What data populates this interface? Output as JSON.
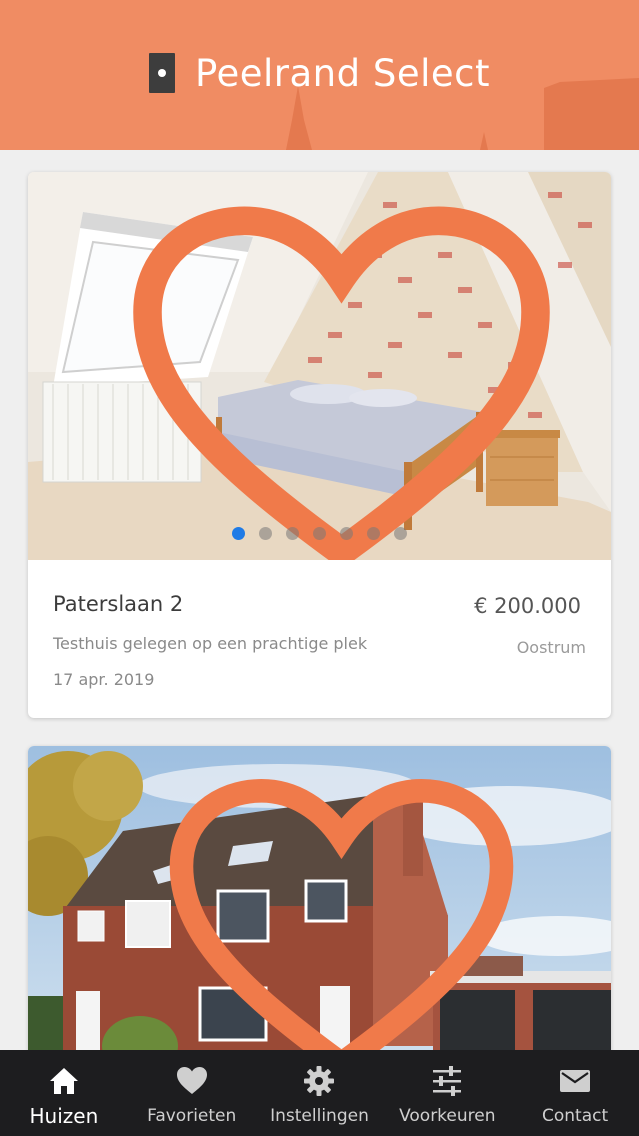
{
  "header": {
    "title": "Peelrand Select",
    "background_color": "#f08c63"
  },
  "listings": [
    {
      "street": "Paterslaan 2",
      "price": "€ 200.000",
      "description": "Testhuis gelegen op een prachtige plek",
      "place": "Oostrum",
      "date": "17 apr. 2019",
      "favorite": false,
      "photo_count": 7,
      "active_photo": 1
    },
    {
      "favorite": false
    }
  ],
  "bottom_nav": {
    "items": [
      {
        "label": "Huizen",
        "icon": "home-icon",
        "active": true
      },
      {
        "label": "Favorieten",
        "icon": "heart-icon",
        "active": false
      },
      {
        "label": "Instellingen",
        "icon": "gear-icon",
        "active": false
      },
      {
        "label": "Voorkeuren",
        "icon": "sliders-icon",
        "active": false
      },
      {
        "label": "Contact",
        "icon": "envelope-icon",
        "active": false
      }
    ]
  },
  "colors": {
    "accent": "#f08c63",
    "active_dot": "#1f7be6",
    "nav_background": "#1d1d1f"
  }
}
